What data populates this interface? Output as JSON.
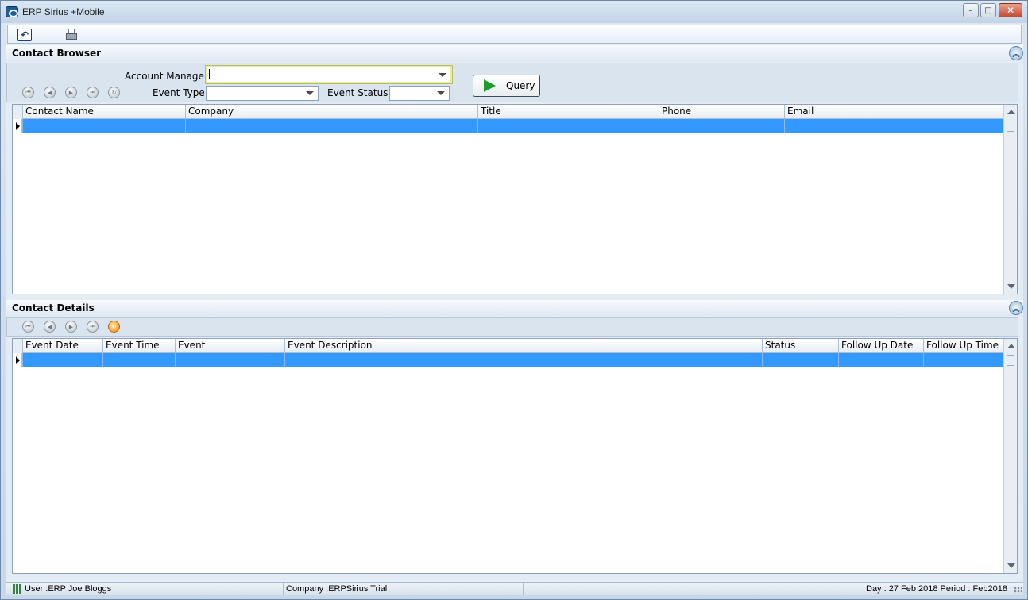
{
  "window": {
    "title": "ERP Sirius +Mobile",
    "controls": {
      "minimize": "–",
      "maximize": "□",
      "close": "✕"
    }
  },
  "toolbar": {
    "items": [
      {
        "name": "undo-icon"
      },
      {
        "name": "printer-icon"
      }
    ]
  },
  "contact_browser": {
    "title": "Contact Browser",
    "account_manager_label": "Account Manager",
    "account_manager_value": "",
    "event_type_label": "Event Type",
    "event_type_value": "",
    "event_status_label": "Event Status",
    "event_status_value": "",
    "query_label": "Query",
    "columns": [
      "Contact Name",
      "Company",
      "Title",
      "Phone",
      "Email"
    ],
    "rows": [
      [
        "",
        "",
        "",
        "",
        ""
      ]
    ]
  },
  "contact_details": {
    "title": "Contact Details",
    "columns": [
      "Event Date",
      "Event Time",
      "Event",
      "Event Description",
      "Status",
      "Follow Up Date",
      "Follow Up Time"
    ],
    "rows": [
      [
        "",
        "",
        "",
        "",
        "",
        "",
        ""
      ]
    ]
  },
  "status": {
    "user": "User :ERP Joe Bloggs",
    "company": "Company :ERPSirius Trial",
    "day_period": "Day : 27 Feb 2018  Period : Feb2018"
  },
  "colors": {
    "selected_row": "#3399ff",
    "query_arrow": "#1e9c2a",
    "refresh_active": "#f08a10"
  }
}
